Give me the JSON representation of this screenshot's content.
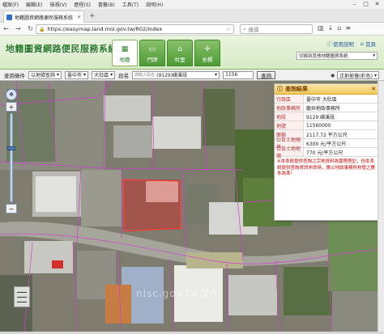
{
  "menubar": {
    "items": [
      "檔案(F)",
      "編輯(E)",
      "檢視(V)",
      "歷程(S)",
      "書籤(B)",
      "工具(T)",
      "說明(H)"
    ]
  },
  "tab": {
    "title": "地籍圖資網路便民服務系統"
  },
  "address": {
    "url": "https://easymap.land.moi.gov.tw/R02/Index"
  },
  "search": {
    "placeholder": "搜尋"
  },
  "header": {
    "logo": "地籍圖資網路便民服務系統",
    "tabs": [
      {
        "label": "地籍",
        "icon": "map-icon",
        "active": true
      },
      {
        "label": "門牌",
        "icon": "door-icon",
        "active": false
      },
      {
        "label": "村里",
        "icon": "village-icon",
        "active": false
      },
      {
        "label": "坐標",
        "icon": "coordinate-icon",
        "active": false
      }
    ],
    "help": "使用說明",
    "home": "首頁",
    "system_select": "切換到其他地籍圖資系統"
  },
  "query": {
    "label": "查詢條件",
    "type": "以地號查詢",
    "city": "臺中市",
    "district": "大肚區",
    "section_label": "段名",
    "section_hint": "請輸入段名",
    "section": "(9129)磺溪段",
    "parcel": "1156",
    "button": "查詢"
  },
  "layers": {
    "basemap": "正射影像(彩色)"
  },
  "result": {
    "title": "查詢結果",
    "rows": [
      {
        "k": "行政區",
        "v": "臺中市 大肚區"
      },
      {
        "k": "地政事務所",
        "v": "龍井地政事務所"
      },
      {
        "k": "地段",
        "v": "9129 磺溪段"
      },
      {
        "k": "地號",
        "v": "11560000"
      },
      {
        "k": "面積",
        "v": "2117.72 平方公尺"
      },
      {
        "k": "公告土地現值",
        "v": "6300 元/平方公尺"
      },
      {
        "k": "公告土地地價",
        "v": "770 元/平方公尺"
      }
    ],
    "note": "※本系統提供查詢之宗地資料為實際登記，但本系統提供查詢資訊非即時，應以地政事務所核發之謄本為準！"
  },
  "map": {
    "watermark": "nlsc.gov.tw/20"
  }
}
